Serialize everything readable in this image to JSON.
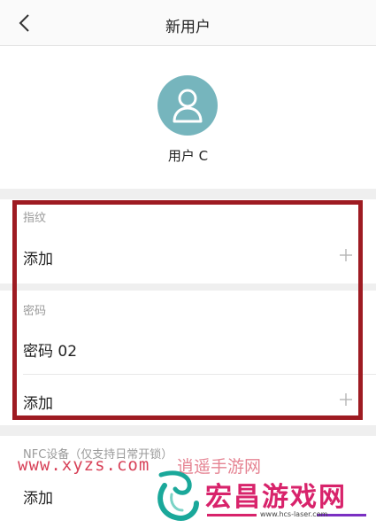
{
  "header": {
    "title": "新用户",
    "back_icon": "chevron-left-icon"
  },
  "profile": {
    "avatar_icon": "user-icon",
    "avatar_color": "#76b5bd",
    "name": "用户 C"
  },
  "fingerprint": {
    "label": "指纹",
    "add_label": "添加"
  },
  "password": {
    "label": "密码",
    "items": [
      "密码 02"
    ],
    "add_label": "添加"
  },
  "nfc": {
    "label": "NFC设备（仅支持日常开锁）",
    "add_label": "添加"
  },
  "colors": {
    "highlight_border": "#9e1b22",
    "watermark_red": "#d11f3a",
    "watermark_pink": "#d8236b"
  },
  "watermark": {
    "url": "www.xyzs.com",
    "url_cn": "逍遥手游网",
    "brand": "宏昌游戏网",
    "domain": "www.hcs-laser.com"
  }
}
